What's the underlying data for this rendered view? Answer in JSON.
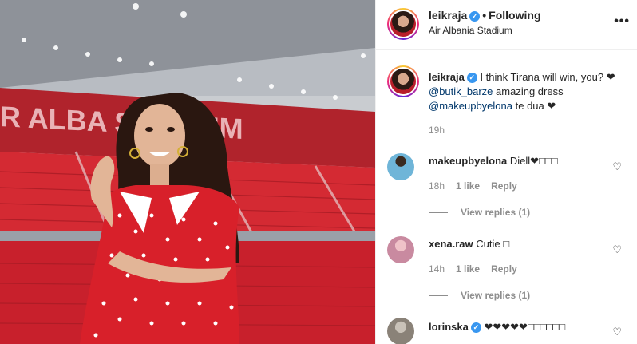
{
  "header": {
    "username": "leikraja",
    "separator": "•",
    "follow_status": "Following",
    "location": "Air Albania Stadium",
    "more_label": "•••"
  },
  "photo": {
    "stadium_sign": "R ALBA   STADIUM"
  },
  "caption": {
    "username": "leikraja",
    "text_1": "I think Tirana will win, you?",
    "heart_1": "❤",
    "mention_1": "@butik_barze",
    "text_2": "amazing dress",
    "mention_2": "@makeupbyelona",
    "text_3": "te dua",
    "heart_2": "❤",
    "time": "19h"
  },
  "comments": [
    {
      "username": "makeupbyelona",
      "text": "Diell❤□□□",
      "time": "18h",
      "likes": "1 like",
      "reply": "Reply",
      "view_replies": "View replies (1)",
      "heart": "♡"
    },
    {
      "username": "xena.raw",
      "text": "Cutie □",
      "time": "14h",
      "likes": "1 like",
      "reply": "Reply",
      "view_replies": "View replies (1)",
      "heart": "♡"
    },
    {
      "username": "lorinska",
      "text": "❤❤❤❤❤□□□□□□",
      "heart": "♡"
    }
  ],
  "colors": {
    "verified": "#3897f0",
    "mention": "#00376b",
    "muted": "#8e8e8e",
    "stadium_red": "#c8202c"
  }
}
